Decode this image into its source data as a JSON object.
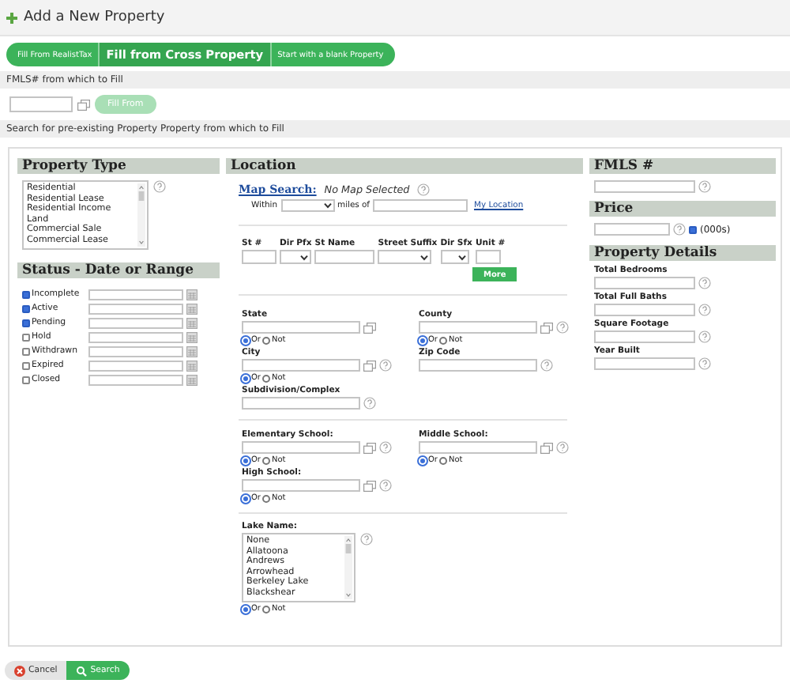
{
  "title": "Add a New Property",
  "tabs": [
    {
      "label": "Fill From RealistTax",
      "selected": false
    },
    {
      "label": "Fill from Cross Property",
      "selected": true
    },
    {
      "label": "Start with a blank Property",
      "selected": false
    }
  ],
  "fill_section": {
    "heading": "FMLS# from which to Fill",
    "button": {
      "label": "Fill From",
      "disabled": true
    }
  },
  "search_heading": "Search for pre-existing Property Property from which to Fill",
  "property_type": {
    "title": "Property Type",
    "options": [
      "Residential",
      "Residential Lease",
      "Residential Income",
      "Land",
      "Commercial Sale",
      "Commercial Lease"
    ]
  },
  "status": {
    "title": "Status - Date or Range",
    "items": [
      {
        "label": "Incomplete",
        "checked": true
      },
      {
        "label": "Active",
        "checked": true
      },
      {
        "label": "Pending",
        "checked": true
      },
      {
        "label": "Hold",
        "checked": false
      },
      {
        "label": "Withdrawn",
        "checked": false
      },
      {
        "label": "Expired",
        "checked": false
      },
      {
        "label": "Closed",
        "checked": false
      }
    ]
  },
  "location": {
    "title": "Location",
    "map_search": {
      "link": "Map Search:",
      "value": "No Map Selected"
    },
    "within": {
      "label": "Within",
      "miles": "miles of",
      "link": "My Location"
    },
    "street": {
      "columns": [
        {
          "label": "St #",
          "kind": "text"
        },
        {
          "label": "Dir Pfx",
          "kind": "select"
        },
        {
          "label": "St Name",
          "kind": "text"
        },
        {
          "label": "Street Suffix",
          "kind": "select"
        },
        {
          "label": "Dir Sfx",
          "kind": "select"
        },
        {
          "label": "Unit #",
          "kind": "text"
        }
      ],
      "more": "More"
    },
    "area_rows": [
      [
        {
          "label": "State",
          "picker": true,
          "help": false,
          "radios": [
            {
              "label": "Or",
              "selected": true
            },
            {
              "label": "Not",
              "selected": false
            }
          ]
        },
        {
          "label": "County",
          "picker": true,
          "help": true,
          "radios": [
            {
              "label": "Or",
              "selected": true
            },
            {
              "label": "Not",
              "selected": false
            }
          ]
        }
      ],
      [
        {
          "label": "City",
          "picker": true,
          "help": true,
          "radios": [
            {
              "label": "Or",
              "selected": true
            },
            {
              "label": "Not",
              "selected": false
            }
          ]
        },
        {
          "label": "Zip Code",
          "picker": false,
          "help": true
        }
      ],
      [
        {
          "label": "Subdivision/Complex",
          "picker": false,
          "help": true
        }
      ]
    ],
    "school_rows": [
      [
        {
          "label": "Elementary School:",
          "picker": true,
          "help": true,
          "radios": [
            {
              "label": "Or",
              "selected": true
            },
            {
              "label": "Not",
              "selected": false
            }
          ]
        },
        {
          "label": "Middle School:",
          "picker": true,
          "help": true,
          "radios": [
            {
              "label": "Or",
              "selected": true
            },
            {
              "label": "Not",
              "selected": false
            }
          ]
        }
      ],
      [
        {
          "label": "High School:",
          "picker": true,
          "help": true,
          "radios": [
            {
              "label": "Or",
              "selected": true
            },
            {
              "label": "Not",
              "selected": false
            }
          ]
        }
      ]
    ],
    "lake": {
      "label": "Lake Name:",
      "options": [
        "None",
        "Allatoona",
        "Andrews",
        "Arrowhead",
        "Berkeley Lake",
        "Blackshear"
      ],
      "radios": [
        {
          "label": "Or",
          "selected": true
        },
        {
          "label": "Not",
          "selected": false
        }
      ]
    }
  },
  "fmls": {
    "title": "FMLS #"
  },
  "price": {
    "title": "Price",
    "unit": {
      "label": "(000s)",
      "checked": true
    }
  },
  "details": {
    "title": "Property Details",
    "fields": [
      "Total Bedrooms",
      "Total Full Baths",
      "Square Footage",
      "Year Built"
    ]
  },
  "actions": [
    {
      "label": "Cancel",
      "kind": "cancel"
    },
    {
      "label": "Search",
      "kind": "search"
    }
  ]
}
